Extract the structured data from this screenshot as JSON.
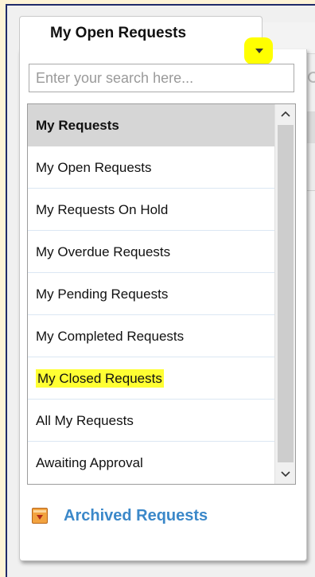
{
  "dropdown": {
    "selected_label": "My Open Requests",
    "arrow_icon": "caret-down-icon",
    "highlight_color": "#ffff00"
  },
  "search": {
    "placeholder": "Enter your search here..."
  },
  "list": {
    "header": "My Requests",
    "items": [
      {
        "label": "My Open Requests"
      },
      {
        "label": "My Requests On Hold"
      },
      {
        "label": "My Overdue Requests"
      },
      {
        "label": "My Pending Requests"
      },
      {
        "label": "My Completed Requests"
      },
      {
        "label": "My Closed Requests",
        "highlighted": true
      },
      {
        "label": "All My Requests"
      },
      {
        "label": "Awaiting Approval"
      }
    ]
  },
  "scrollbar": {
    "up_icon": "chevron-up-icon",
    "down_icon": "chevron-down-icon"
  },
  "archived": {
    "label": "Archived Requests",
    "icon": "archive-box-icon",
    "color": "#3b88c9"
  }
}
